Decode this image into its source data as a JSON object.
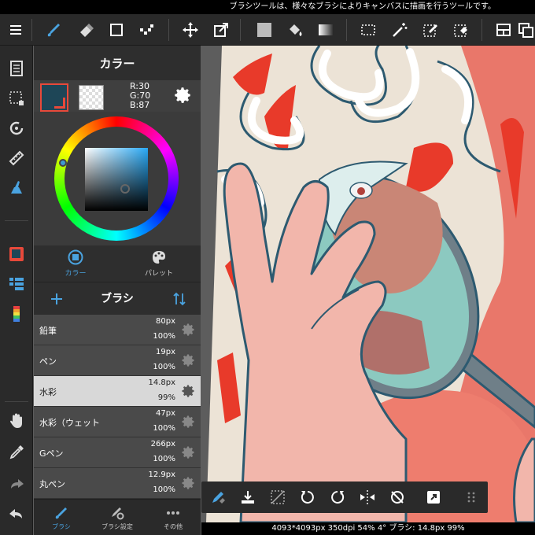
{
  "status_text": "ブラシツールは、様々なブラシによりキャンバスに描画を行うツールです。",
  "toolbar": {
    "icons": [
      "menu-icon",
      "brush-icon",
      "eraser-icon",
      "shape-icon",
      "dot-icon",
      "move-icon",
      "transform-icon",
      "fill-color-icon",
      "bucket-icon",
      "gradient-icon",
      "select-icon",
      "magic-wand-icon",
      "select-pen-icon",
      "select-eraser-icon",
      "layout-icon",
      "layers-icon"
    ]
  },
  "rail": {
    "icons": [
      "pages-icon",
      "selection-icon",
      "rotate-icon",
      "ruler-icon",
      "filter-brush-icon",
      "color-icon",
      "layer-list-icon",
      "palette-strip-icon",
      "hand-icon",
      "eyedropper-icon",
      "redo-icon",
      "undo-icon"
    ]
  },
  "color_panel": {
    "title": "カラー",
    "r": "R:30",
    "g": "G:70",
    "b": "B:87",
    "main_color": "#1e4657",
    "tab_color": "カラー",
    "tab_palette": "パレット"
  },
  "brush_panel": {
    "title": "ブラシ",
    "brushes": [
      {
        "name": "鉛筆",
        "size": "80px",
        "opacity": "100%"
      },
      {
        "name": "ペン",
        "size": "19px",
        "opacity": "100%"
      },
      {
        "name": "水彩",
        "size": "14.8px",
        "opacity": "99%"
      },
      {
        "name": "水彩（ウェット",
        "size": "47px",
        "opacity": "100%"
      },
      {
        "name": "Gペン",
        "size": "266px",
        "opacity": "100%"
      },
      {
        "name": "丸ペン",
        "size": "12.9px",
        "opacity": "100%"
      }
    ],
    "selected_index": 2
  },
  "panel_tabs": {
    "brush": "ブラシ",
    "brush_settings": "ブラシ設定",
    "other": "その他"
  },
  "canvas_info": "4093*4093px 350dpi 54% 4° ブラシ: 14.8px 99%",
  "colors": {
    "accent": "#4aa3e0",
    "selected_swatch_border": "#e8493a",
    "canvas_bg": "#e9c9b8"
  }
}
